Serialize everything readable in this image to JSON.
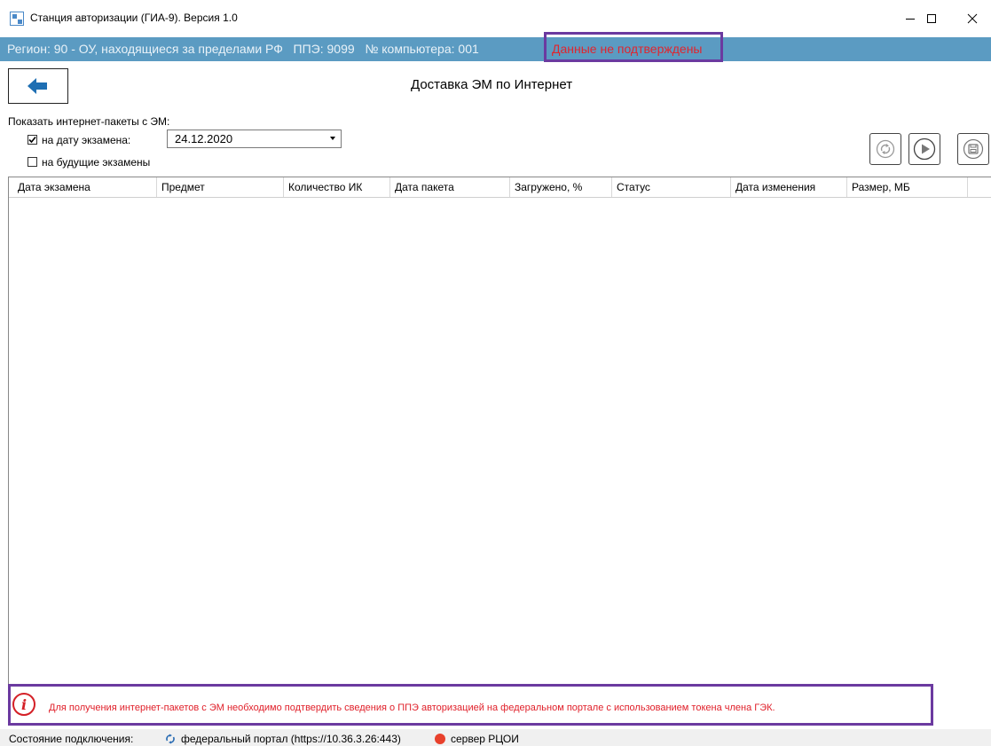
{
  "window": {
    "title": "Станция авторизации (ГИА-9). Версия 1.0",
    "icons": {
      "app": "app-icon",
      "minimize": "minimize-icon",
      "maximize": "maximize-icon",
      "close": "close-icon"
    }
  },
  "infobar": {
    "region": "Регион: 90 - ОУ, находящиеся за пределами РФ",
    "ppe": "ППЭ: 9099",
    "computer": "№ компьютера: 001",
    "status": "Данные не подтверждены",
    "status_color": "#e0252e",
    "background": "#5b9bc2"
  },
  "page": {
    "title": "Доставка ЭМ по Интернет",
    "back_icon": "arrow-left-icon"
  },
  "filters": {
    "show_label": "Показать интернет-пакеты с ЭМ:",
    "by_date_label": "на дату экзамена:",
    "by_date_checked": true,
    "future_label": "на будущие экзамены",
    "future_checked": false,
    "date_value": "24.12.2020"
  },
  "actions": {
    "refresh_icon": "refresh-icon",
    "play_icon": "play-icon",
    "save_icon": "save-icon"
  },
  "table": {
    "columns": [
      "Дата экзамена",
      "Предмет",
      "Количество ИК",
      "Дата пакета",
      "Загружено, %",
      "Статус",
      "Дата изменения",
      "Размер, МБ"
    ],
    "rows": []
  },
  "message": {
    "icon": "info-icon",
    "text": "Для получения интернет-пакетов с ЭМ необходимо подтвердить сведения о ППЭ авторизацией на федеральном портале с использованием токена члена ГЭК."
  },
  "statusbar": {
    "label": "Состояние подключения:",
    "federal": "федеральный портал (https://10.36.3.26:443)",
    "federal_icon": "sync-icon",
    "rcoi": "сервер РЦОИ",
    "rcoi_icon": "status-dot-icon",
    "rcoi_color": "#e8412c"
  }
}
